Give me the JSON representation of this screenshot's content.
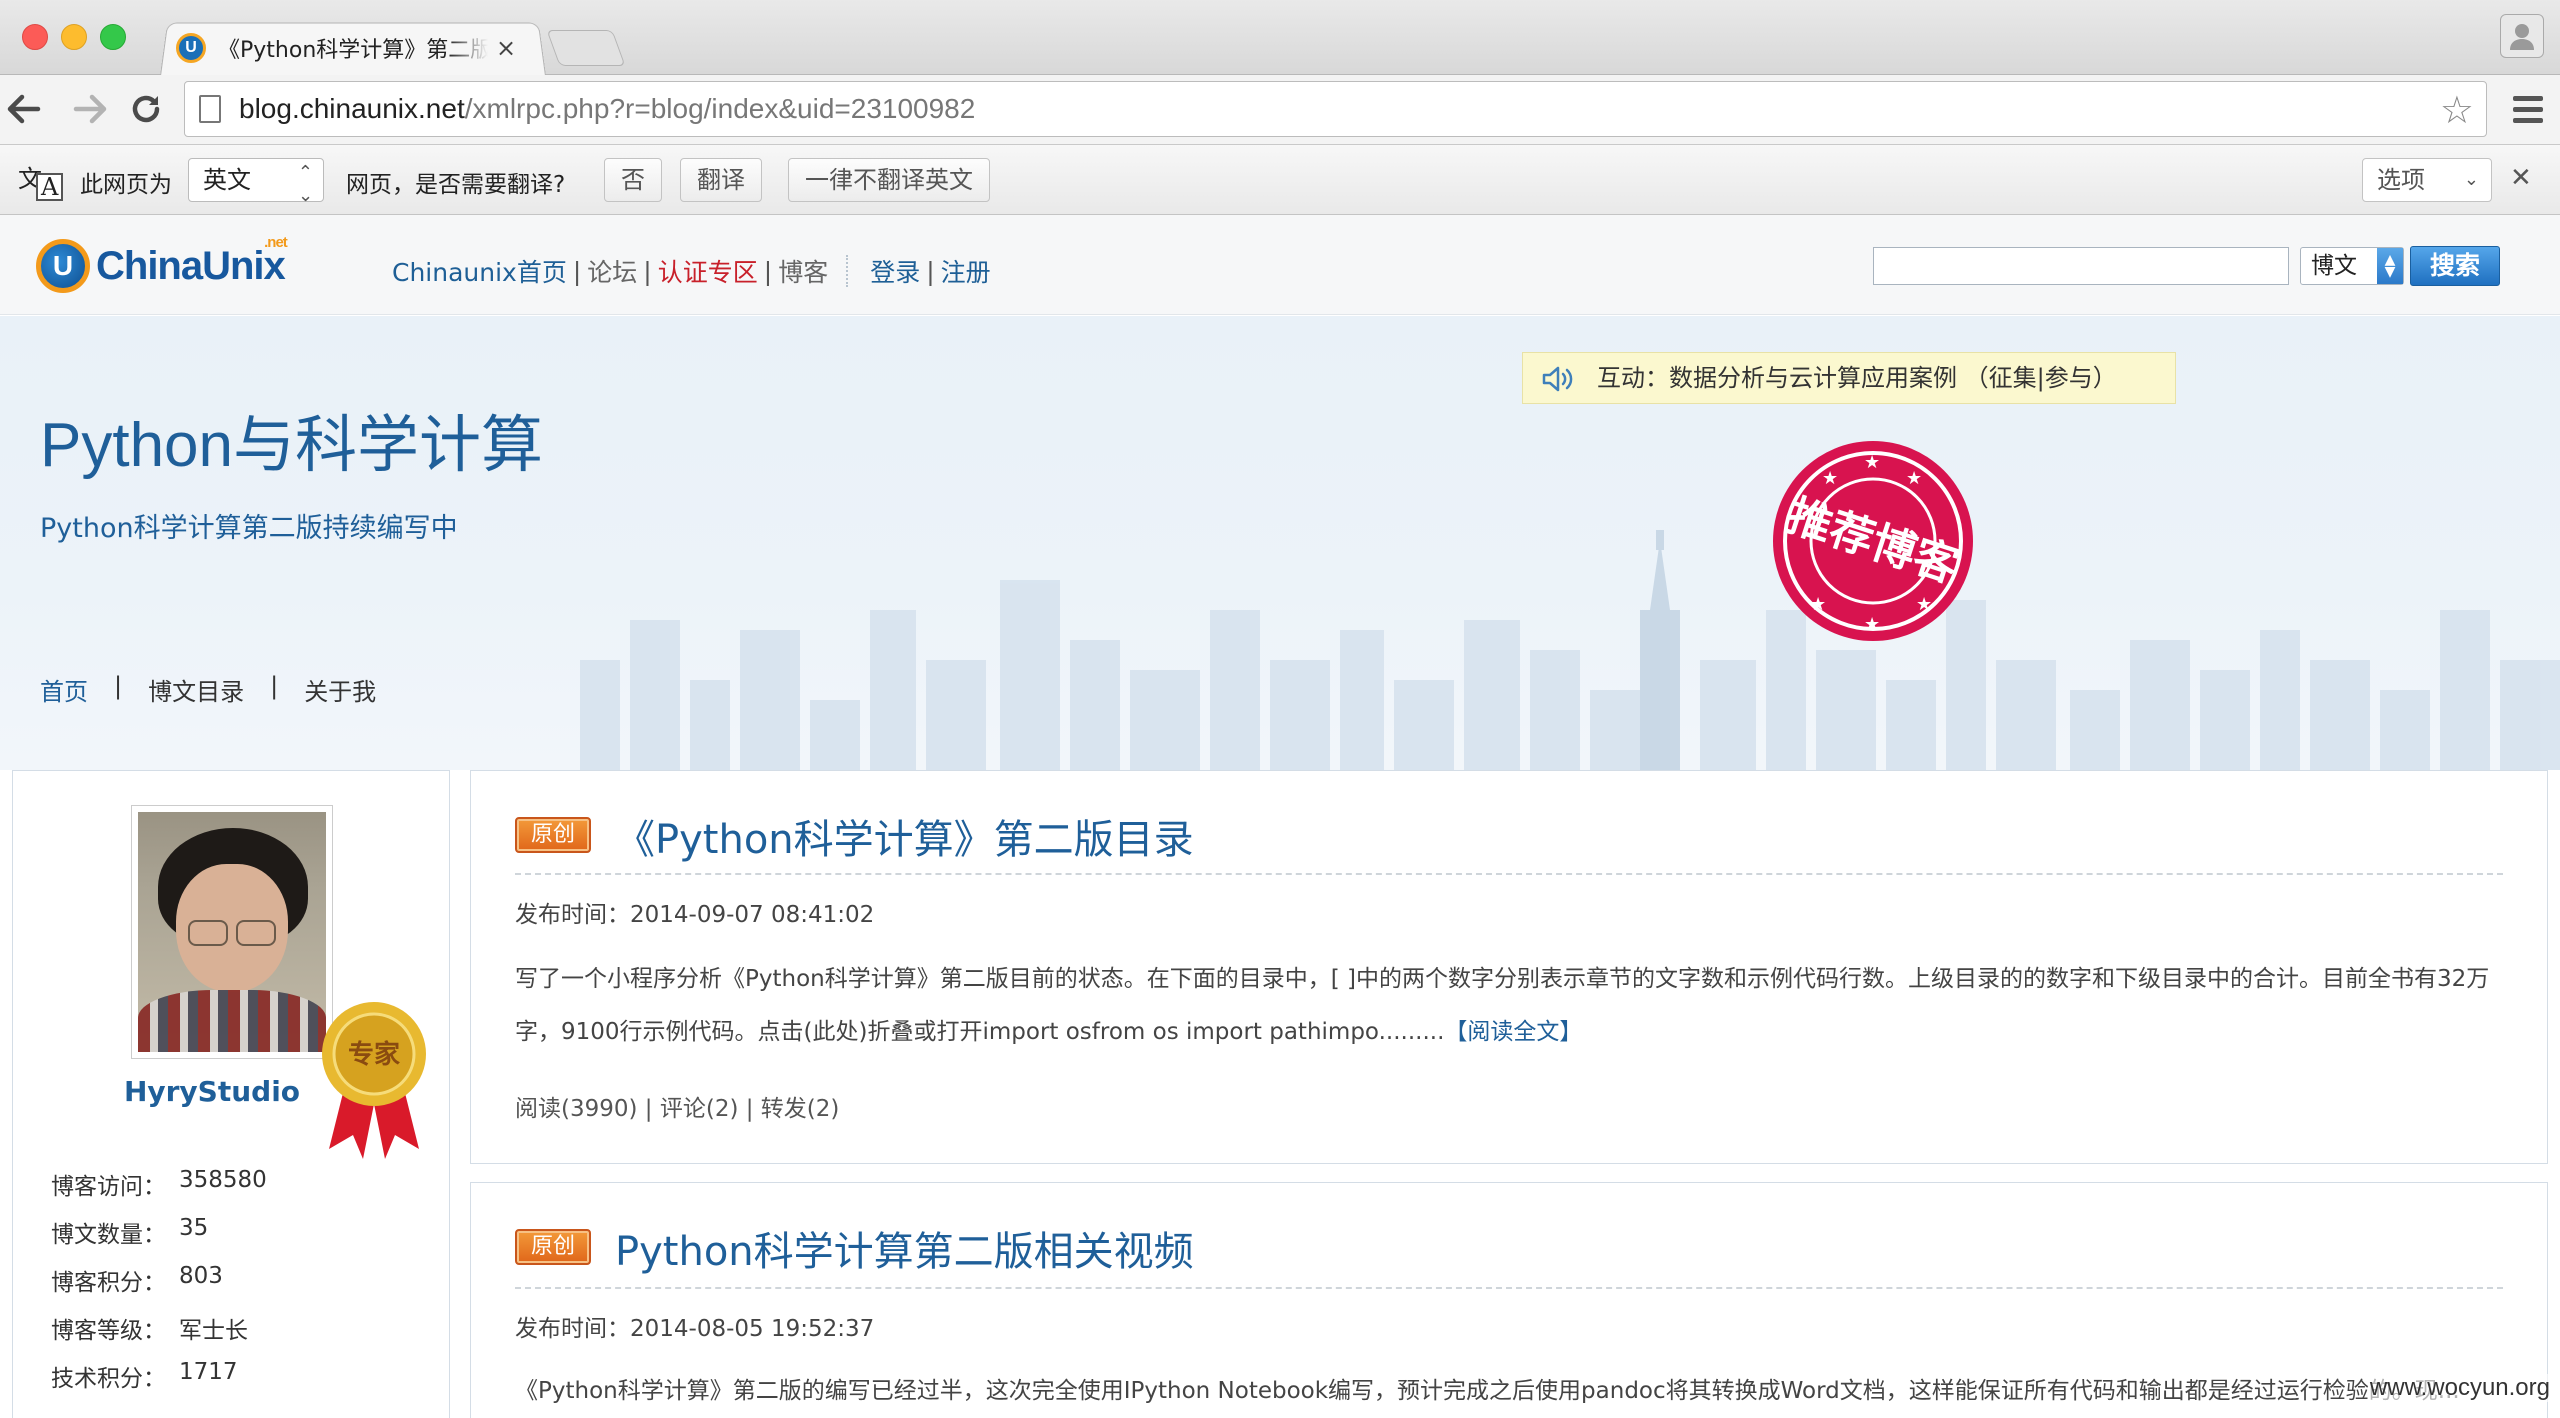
{
  "browser": {
    "tab_title": "《Python科学计算》第二版目",
    "url_host": "blog.chinaunix.net",
    "url_path": "/xmlrpc.php?r=blog/index&uid=23100982"
  },
  "translate_bar": {
    "prefix": "此网页为",
    "language": "英文",
    "question": "网页，是否需要翻译?",
    "no_label": "否",
    "translate_label": "翻译",
    "never_label": "一律不翻译英文",
    "options_label": "选项"
  },
  "site": {
    "logo_text": "ChinaUnix",
    "logo_net": ".net",
    "nav": {
      "home": "Chinaunix首页",
      "forum": "论坛",
      "cert": "认证专区",
      "blog": "博客",
      "login": "登录",
      "register": "注册"
    },
    "search_category": "博文",
    "search_button": "搜索"
  },
  "banner": {
    "title": "Python与科学计算",
    "subtitle": "Python科学计算第二版持续编写中",
    "notice": "互动：数据分析与云计算应用案例 （征集|参与）",
    "stamp_text": "推荐博客",
    "nav": [
      "首页",
      "博文目录",
      "关于我"
    ]
  },
  "profile": {
    "username": "HyryStudio",
    "medal_text": "专家",
    "stats": [
      {
        "label": "博客访问：",
        "value": "358580"
      },
      {
        "label": "博文数量：",
        "value": "35"
      },
      {
        "label": "博客积分：",
        "value": "803"
      },
      {
        "label": "博客等级：",
        "value": "军士长"
      },
      {
        "label": "技术积分：",
        "value": "1717"
      }
    ]
  },
  "posts": [
    {
      "badge": "原创",
      "title": "《Python科学计算》第二版目录",
      "date": "发布时间：2014-09-07 08:41:02",
      "excerpt": "写了一个小程序分析《Python科学计算》第二版目前的状态。在下面的目录中，[ ]中的两个数字分别表示章节的文字数和示例代码行数。上级目录的的数字和下级目录中的合计。目前全书有32万字，9100行示例代码。点击(此处)折叠或打开import osfrom os import pathimpo.........",
      "more": "【阅读全文】",
      "meta": "阅读(3990) | 评论(2) | 转发(2)"
    },
    {
      "badge": "原创",
      "title": "Python科学计算第二版相关视频",
      "date": "发布时间：2014-08-05 19:52:37",
      "excerpt": "《Python科学计算》第二版的编写已经过半，这次完全使用IPython Notebook编写，预计完成之后使用pandoc将其转换成Word文档，这样能保证所有代码和输出都是经过运行检验的。现..."
    }
  ],
  "watermark": "www.wocyun.org",
  "colors": {
    "link_blue": "#1f5f99",
    "cert_red": "#c8202a",
    "badge_orange": "#e0661a",
    "stamp_red": "#d8134f"
  }
}
